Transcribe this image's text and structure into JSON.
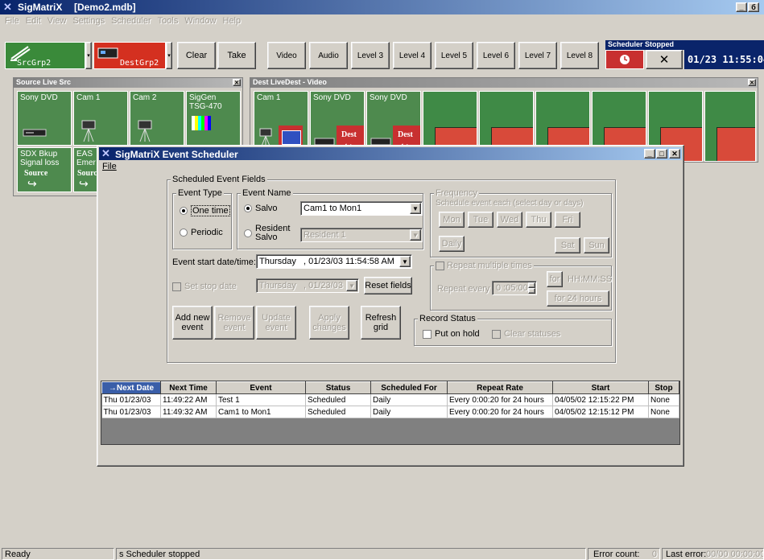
{
  "app": {
    "title": "SigMatriX",
    "file": "[Demo2.mdb]",
    "menu": [
      "File",
      "Edit",
      "View",
      "Settings",
      "Scheduler",
      "Tools",
      "Window",
      "Help"
    ],
    "title_controls": [
      "_",
      "б"
    ]
  },
  "toolbar": {
    "src_group": "SrcGrp2",
    "dest_group": "DestGrp2",
    "clear": "Clear",
    "take": "Take",
    "levels": [
      "Video",
      "Audio",
      "Level 3",
      "Level 4",
      "Level 5",
      "Level 6",
      "Level 7",
      "Level 8"
    ],
    "scheduler_status": "Scheduler Stopped",
    "scheduler_close": "✕",
    "clock": "01/23 11:55:04"
  },
  "source_panel": {
    "title": "Source Live Src",
    "tiles": [
      {
        "label": "Sony DVD"
      },
      {
        "label": "Cam 1"
      },
      {
        "label": "Cam 2"
      },
      {
        "label": "SigGen TSG-470"
      },
      {
        "label": "SDX Bkup Signal loss",
        "sub": "Source"
      },
      {
        "label": "EAS Emer",
        "sub": "Sourc"
      }
    ]
  },
  "dest_panel": {
    "title": "Dest LiveDest - Video",
    "tiles": [
      {
        "label": "Cam 1"
      },
      {
        "label": "Sony DVD",
        "badge": "Dest"
      },
      {
        "label": "Sony DVD",
        "badge": "Dest"
      }
    ]
  },
  "scheduler": {
    "title": "SigMatriX Event Scheduler",
    "menu_file": "File",
    "controls": [
      "_",
      "□",
      "✕"
    ],
    "fields_label": "Scheduled Event Fields",
    "event_type": {
      "label": "Event Type",
      "one_time": "One time",
      "periodic": "Periodic"
    },
    "event_name": {
      "label": "Event Name",
      "salvo": "Salvo",
      "salvo_value": "Cam1 to Mon1",
      "resident_salvo": "Resident Salvo",
      "resident_value": "Resident 1"
    },
    "start_label": "Event start date/time:",
    "start_value": "Thursday   , 01/23/03 11:54:58 AM",
    "set_stop_label": "Set stop date",
    "stop_value": "Thursday   , 01/23/03",
    "reset_fields": "Reset fields",
    "buttons": {
      "add": "Add new event",
      "remove": "Remove event",
      "update": "Update event",
      "apply": "Apply changes",
      "refresh": "Refresh grid"
    },
    "frequency": {
      "label": "Frequency",
      "hint": "Schedule event each (select day or days)",
      "days": [
        "Mon",
        "Tue",
        "Wed",
        "Thu",
        "Fri",
        "Sat",
        "Sun"
      ],
      "daily": "Daily"
    },
    "repeat": {
      "label": "Repeat multiple times",
      "every_label": "Repeat every",
      "every_value": "0 :05:00",
      "for": "for",
      "format": "HH:MM:SS",
      "for_24": "for 24 hours"
    },
    "record_status": {
      "label": "Record Status",
      "put_on_hold": "Put on hold",
      "clear_statuses": "Clear statuses"
    },
    "grid": {
      "columns": [
        "→Next Date",
        "Next Time",
        "Event",
        "Status",
        "Scheduled For",
        "Repeat Rate",
        "Start",
        "Stop"
      ],
      "rows": [
        [
          "Thu 01/23/03",
          "11:49:22 AM",
          "Test 1",
          "Scheduled",
          "Daily",
          "Every 0:00:20 for 24 hours",
          "04/05/02 12:15:22 PM",
          "None"
        ],
        [
          "Thu 01/23/03",
          "11:49:32 AM",
          "Cam1 to Mon1",
          "Scheduled",
          "Daily",
          "Every 0:00:20 for 24 hours",
          "04/05/02 12:15:12 PM",
          "None"
        ]
      ]
    }
  },
  "statusbar": {
    "ready": "Ready",
    "scheduler": "s Scheduler stopped",
    "error_count_label": "Error count:",
    "error_count": "0",
    "last_error_label": "Last error:",
    "last_error": "00/00 00:00:00"
  }
}
